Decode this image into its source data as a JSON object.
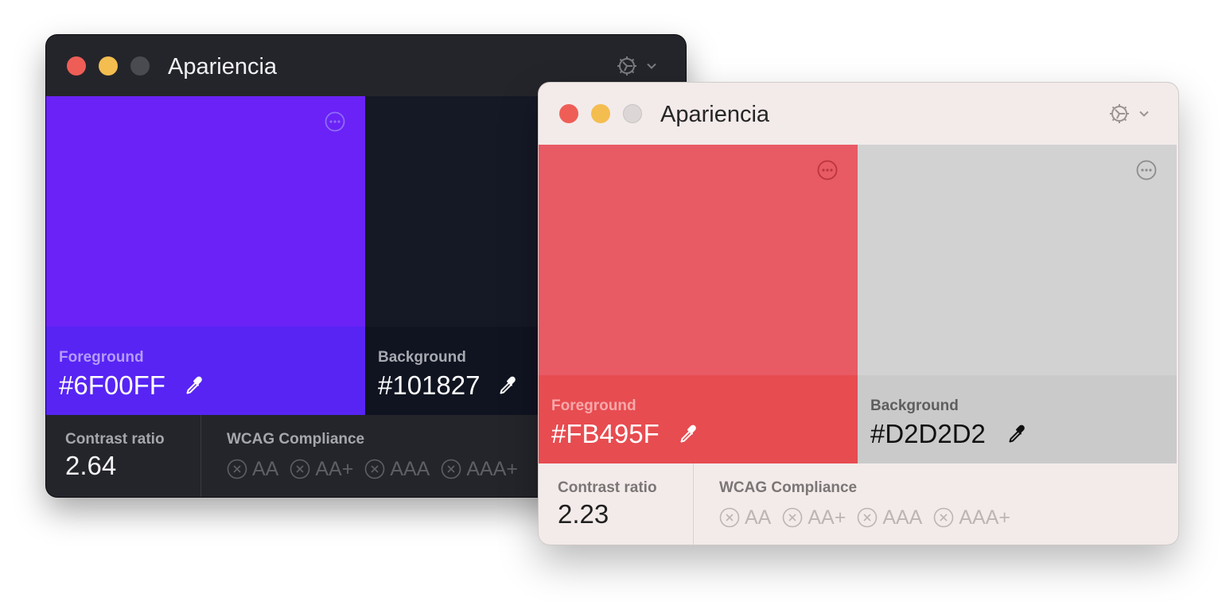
{
  "colors": {
    "dark_fg_top": "#6A22F6",
    "dark_fg_bottom": "#5724F4",
    "dark_bg_top": "#151926",
    "dark_bg_bottom": "#101421",
    "light_fg_top": "#E85A64",
    "light_fg_bottom": "#E74C50",
    "light_bg_top": "#D2D2D2",
    "light_bg_bottom": "#CACACA"
  },
  "dark_window": {
    "title": "Apariencia",
    "foreground": {
      "label": "Foreground",
      "hex": "#6F00FF"
    },
    "background": {
      "label": "Background",
      "hex": "#101827"
    },
    "contrast_label": "Contrast ratio",
    "contrast_value": "2.64",
    "wcag_label": "WCAG Compliance",
    "badges": [
      "AA",
      "AA+",
      "AAA",
      "AAA+"
    ]
  },
  "light_window": {
    "title": "Apariencia",
    "foreground": {
      "label": "Foreground",
      "hex": "#FB495F"
    },
    "background": {
      "label": "Background",
      "hex": "#D2D2D2"
    },
    "contrast_label": "Contrast ratio",
    "contrast_value": "2.23",
    "wcag_label": "WCAG Compliance",
    "badges": [
      "AA",
      "AA+",
      "AAA",
      "AAA+"
    ]
  }
}
